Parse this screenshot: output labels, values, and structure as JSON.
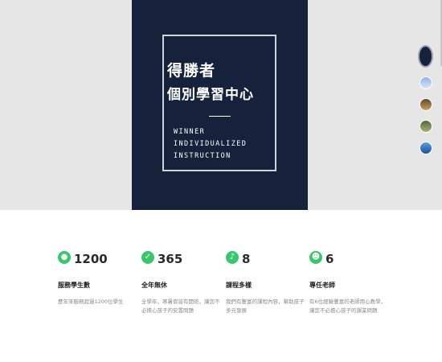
{
  "hero": {
    "title_line1": "得勝者",
    "title_line2": "個別學習中心",
    "english_line1": "WINNER",
    "english_line2": "INDIVIDUALIZED",
    "english_line3": "INSTRUCTION",
    "bg_color": "#16223b"
  },
  "thumbnails": [
    "logo-thumbnail",
    "classroom-thumbnail",
    "class-photo-thumbnail",
    "field-thumbnail",
    "sky-thumbnail"
  ],
  "stats": [
    {
      "icon": "users-icon",
      "number": "1200",
      "label": "服務學生數",
      "desc": "歷年來服務超過1200位學生"
    },
    {
      "icon": "check-icon",
      "number": "365",
      "label": "全年無休",
      "desc": "全學年，寒暑假皆有開班，讓您不必擔心孩子的安置問題"
    },
    {
      "icon": "music-note-icon",
      "number": "8",
      "label": "課程多樣",
      "desc": "我們有豐富的課程內容，幫助孩子多元發展"
    },
    {
      "icon": "teacher-icon",
      "number": "6",
      "label": "專任老師",
      "desc": "有6位經驗豐富的老師用心教學，讓您不必擔心孩子的課業問題"
    }
  ],
  "colors": {
    "accent": "#3ac66b",
    "hero_bg": "#e6e6e6"
  }
}
